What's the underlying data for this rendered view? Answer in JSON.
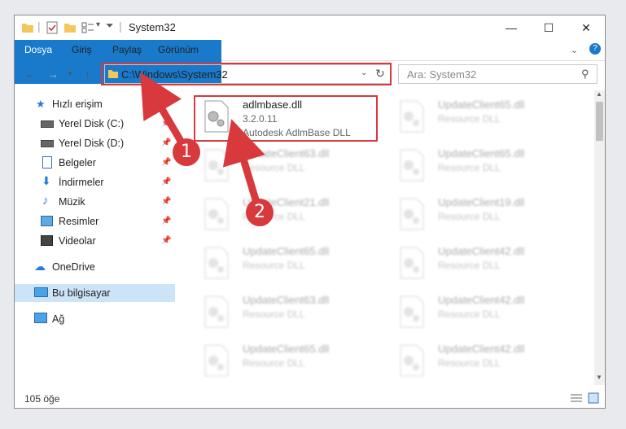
{
  "window": {
    "title": "System32",
    "controls": {
      "minimize": "—",
      "maximize": "☐",
      "close": "✕"
    }
  },
  "ribbon": {
    "tabs": [
      "Dosya",
      "Giriş",
      "Paylaş",
      "Görünüm"
    ],
    "help": "?"
  },
  "address_bar": {
    "path": "C:\\Windows\\System32",
    "search_placeholder": "Ara: System32"
  },
  "nav_pane": {
    "items": [
      {
        "label": "Hızlı erişim",
        "icon": "star-icon",
        "pinned": false
      },
      {
        "label": "Yerel Disk (C:)",
        "icon": "drive-icon",
        "pinned": true
      },
      {
        "label": "Yerel Disk (D:)",
        "icon": "drive-icon",
        "pinned": true
      },
      {
        "label": "Belgeler",
        "icon": "document-icon",
        "pinned": true
      },
      {
        "label": "İndirmeler",
        "icon": "download-icon",
        "pinned": true
      },
      {
        "label": "Müzik",
        "icon": "music-icon",
        "pinned": true
      },
      {
        "label": "Resimler",
        "icon": "pictures-icon",
        "pinned": true
      },
      {
        "label": "Videolar",
        "icon": "video-icon",
        "pinned": true
      },
      {
        "label": "OneDrive",
        "icon": "cloud-icon",
        "pinned": false
      },
      {
        "label": "Bu bilgisayar",
        "icon": "computer-icon",
        "pinned": false
      },
      {
        "label": "Ağ",
        "icon": "network-icon",
        "pinned": false
      }
    ]
  },
  "files": {
    "highlighted": {
      "name": "adlmbase.dll",
      "version": "3.2.0.11",
      "description": "Autodesk AdlmBase DLL"
    },
    "others": [
      {
        "name": "UpdateClient65.dll",
        "description": "Resource DLL"
      },
      {
        "name": "UpdateClient63.dll",
        "description": "Resource DLL"
      },
      {
        "name": "UpdateClient65.dll",
        "description": "Resource DLL"
      },
      {
        "name": "UpdateClient21.dll",
        "description": "Resource DLL"
      },
      {
        "name": "UpdateClient19.dll",
        "description": "Resource DLL"
      },
      {
        "name": "UpdateClient65.dll",
        "description": "Resource DLL"
      },
      {
        "name": "UpdateClient42.dll",
        "description": "Resource DLL"
      },
      {
        "name": "UpdateClient63.dll",
        "description": "Resource DLL"
      },
      {
        "name": "UpdateClient42.dll",
        "description": "Resource DLL"
      },
      {
        "name": "UpdateClient65.dll",
        "description": "Resource DLL"
      },
      {
        "name": "UpdateClient42.dll",
        "description": "Resource DLL"
      }
    ]
  },
  "status": {
    "item_count": "105 öğe"
  },
  "annotations": {
    "badge_1": "1",
    "badge_2": "2",
    "color": "#d8393d"
  }
}
